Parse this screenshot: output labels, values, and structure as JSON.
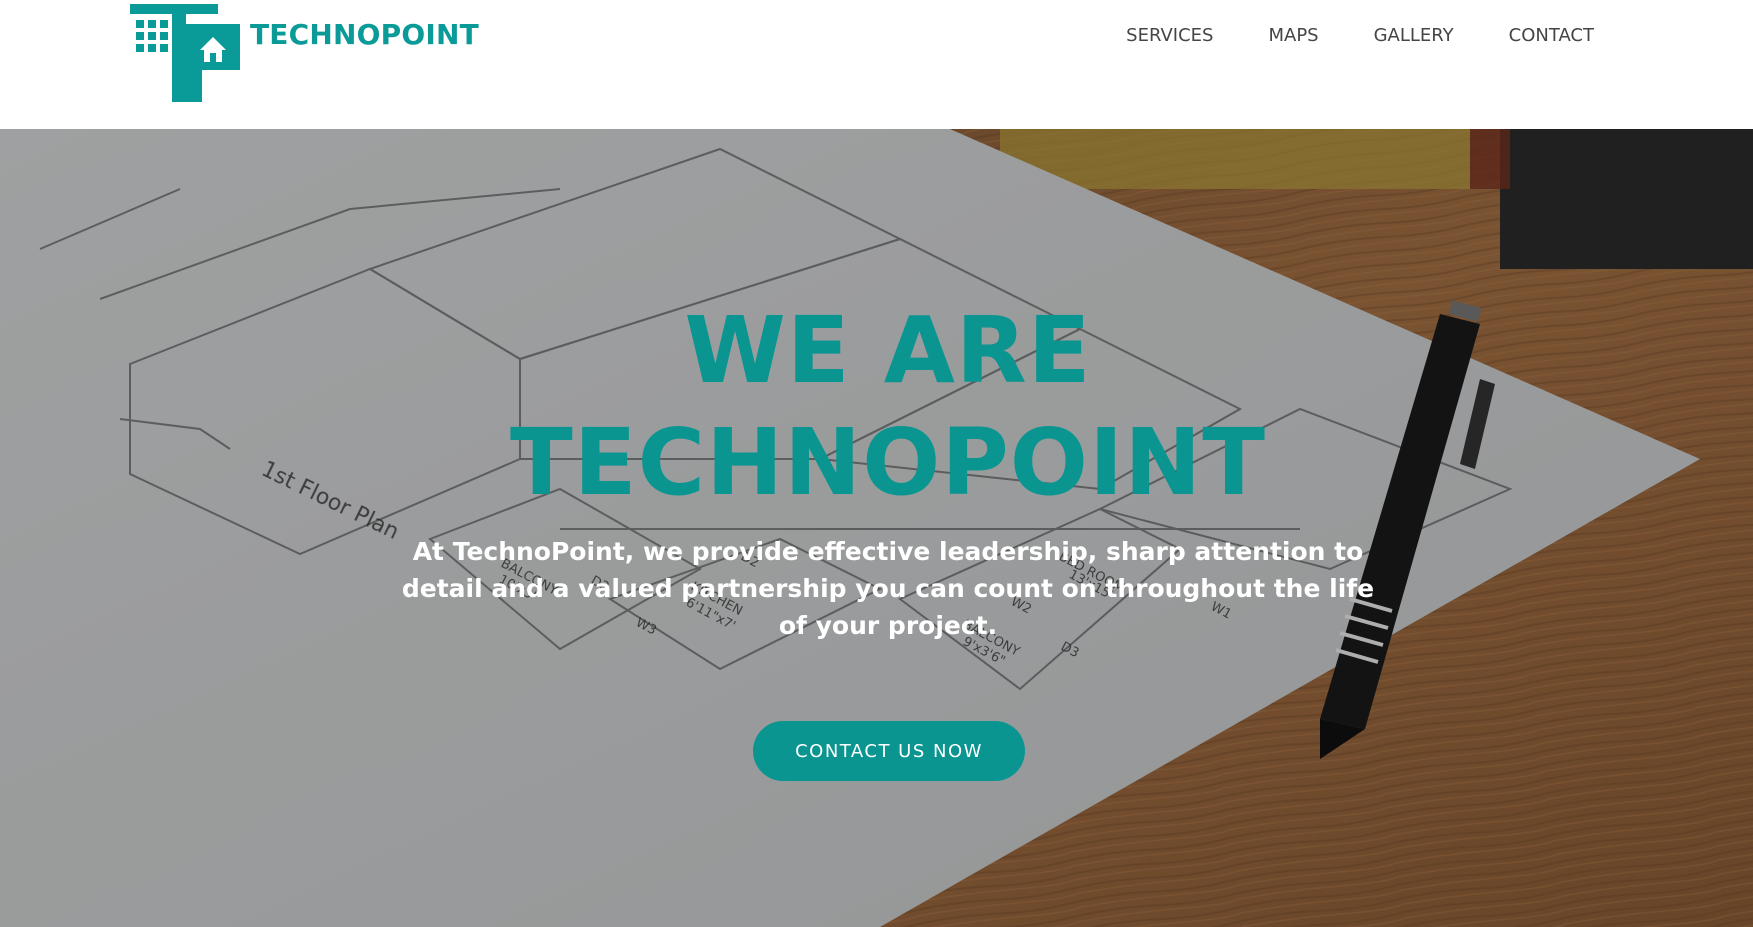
{
  "brand": {
    "name": "TECHNOPOINT",
    "logo_icon": "building-house-logo-icon",
    "color": "#0a9a97"
  },
  "nav": {
    "items": [
      {
        "label": "SERVICES"
      },
      {
        "label": "MAPS"
      },
      {
        "label": "GALLERY"
      },
      {
        "label": "CONTACT"
      }
    ]
  },
  "hero": {
    "title_line1": "WE ARE",
    "title_line2": "TECHNOPOINT",
    "subtitle": "At TechnoPoint, we provide effective leadership, sharp attention to detail and a valued partnership you can count on throughout the life of your project.",
    "cta_label": "CONTACT US NOW",
    "background": "floor-plan-blueprint-with-pen-on-wooden-desk",
    "floor_plan_labels": {
      "plan_title": "1st Floor Plan",
      "bed_room": "BED ROOM",
      "bed_room_size": "13'x15'",
      "kitchen": "KITCHEN",
      "kitchen_size": "6'11\"x7'",
      "balcony": "BALCONY",
      "balcony_size_left": "10'x3'",
      "balcony_size_right": "9'x3'6\"",
      "door_d2": "D2",
      "door_d3": "D3",
      "window_w1": "W1",
      "window_w2": "W2",
      "window_w3": "W3"
    },
    "accent_color": "#0a9591"
  }
}
